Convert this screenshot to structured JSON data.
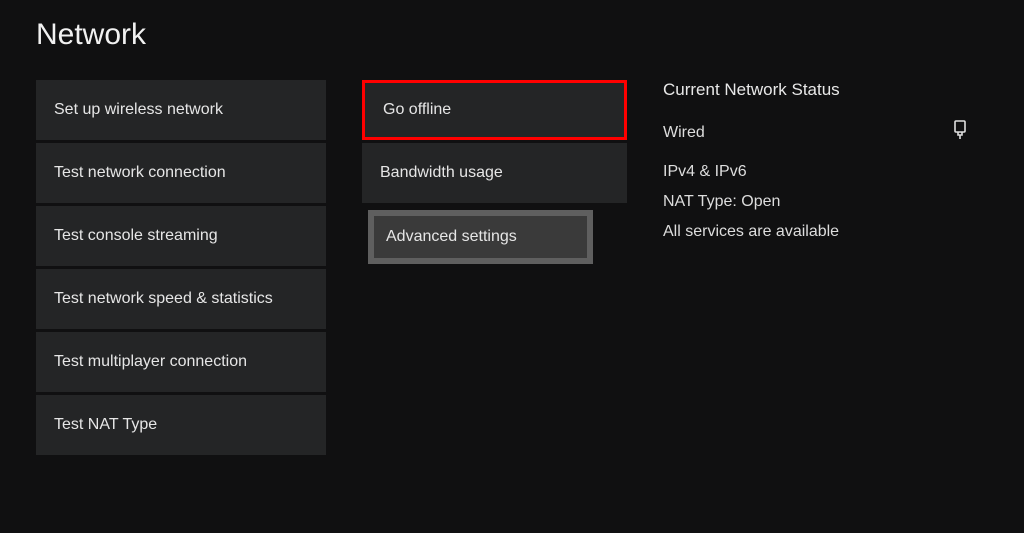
{
  "title": "Network",
  "left_buttons": [
    {
      "label": "Set up wireless network"
    },
    {
      "label": "Test network connection"
    },
    {
      "label": "Test console streaming"
    },
    {
      "label": "Test network speed & statistics"
    },
    {
      "label": "Test multiplayer connection"
    },
    {
      "label": "Test NAT Type"
    }
  ],
  "mid_buttons": {
    "go_offline": "Go offline",
    "bandwidth_usage": "Bandwidth usage",
    "advanced_settings": "Advanced settings"
  },
  "status": {
    "heading": "Current Network Status",
    "connection_type": "Wired",
    "ip_stack": "IPv4 & IPv6",
    "nat": "NAT Type: Open",
    "services": "All services are available"
  }
}
